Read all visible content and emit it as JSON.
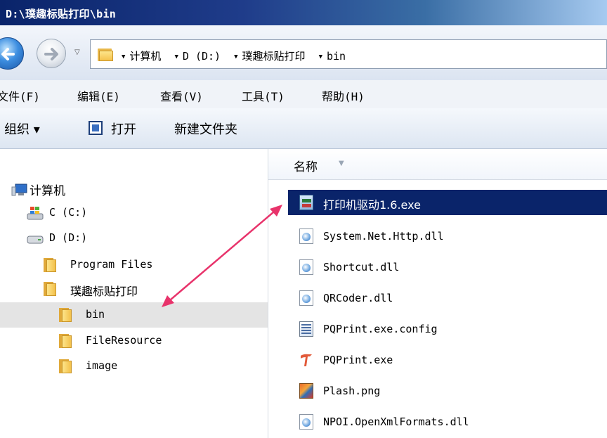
{
  "window": {
    "title": "D:\\璞趣标贴打印\\bin"
  },
  "address_bar": {
    "crumbs": [
      "计算机",
      "D (D:)",
      "璞趣标贴打印",
      "bin"
    ]
  },
  "menu": {
    "items": [
      "文件(F)",
      "编辑(E)",
      "查看(V)",
      "工具(T)",
      "帮助(H)"
    ]
  },
  "toolbar": {
    "organize_label": "组织 ▾",
    "open_label": "打开",
    "new_folder_label": "新建文件夹"
  },
  "nav_tree": {
    "computer": "计算机",
    "c_drive": "C (C:)",
    "d_drive": "D (D:)",
    "program_files": "Program Files",
    "app_folder": "璞趣标贴打印",
    "bin": "bin",
    "file_resource": "FileResource",
    "image": "image"
  },
  "file_list": {
    "column_name": "名称",
    "files": [
      {
        "name": "打印机驱动1.6.exe",
        "type": "installer",
        "selected": true
      },
      {
        "name": "System.Net.Http.dll",
        "type": "dll"
      },
      {
        "name": "Shortcut.dll",
        "type": "dll"
      },
      {
        "name": "QRCoder.dll",
        "type": "dll"
      },
      {
        "name": "PQPrint.exe.config",
        "type": "config"
      },
      {
        "name": "PQPrint.exe",
        "type": "exe"
      },
      {
        "name": "Plash.png",
        "type": "png"
      },
      {
        "name": "NPOI.OpenXmlFormats.dll",
        "type": "dll"
      }
    ]
  },
  "colors": {
    "selection": "#0a246a",
    "annotation_arrow": "#e8336b",
    "tree_selected": "#e4e4e4"
  }
}
